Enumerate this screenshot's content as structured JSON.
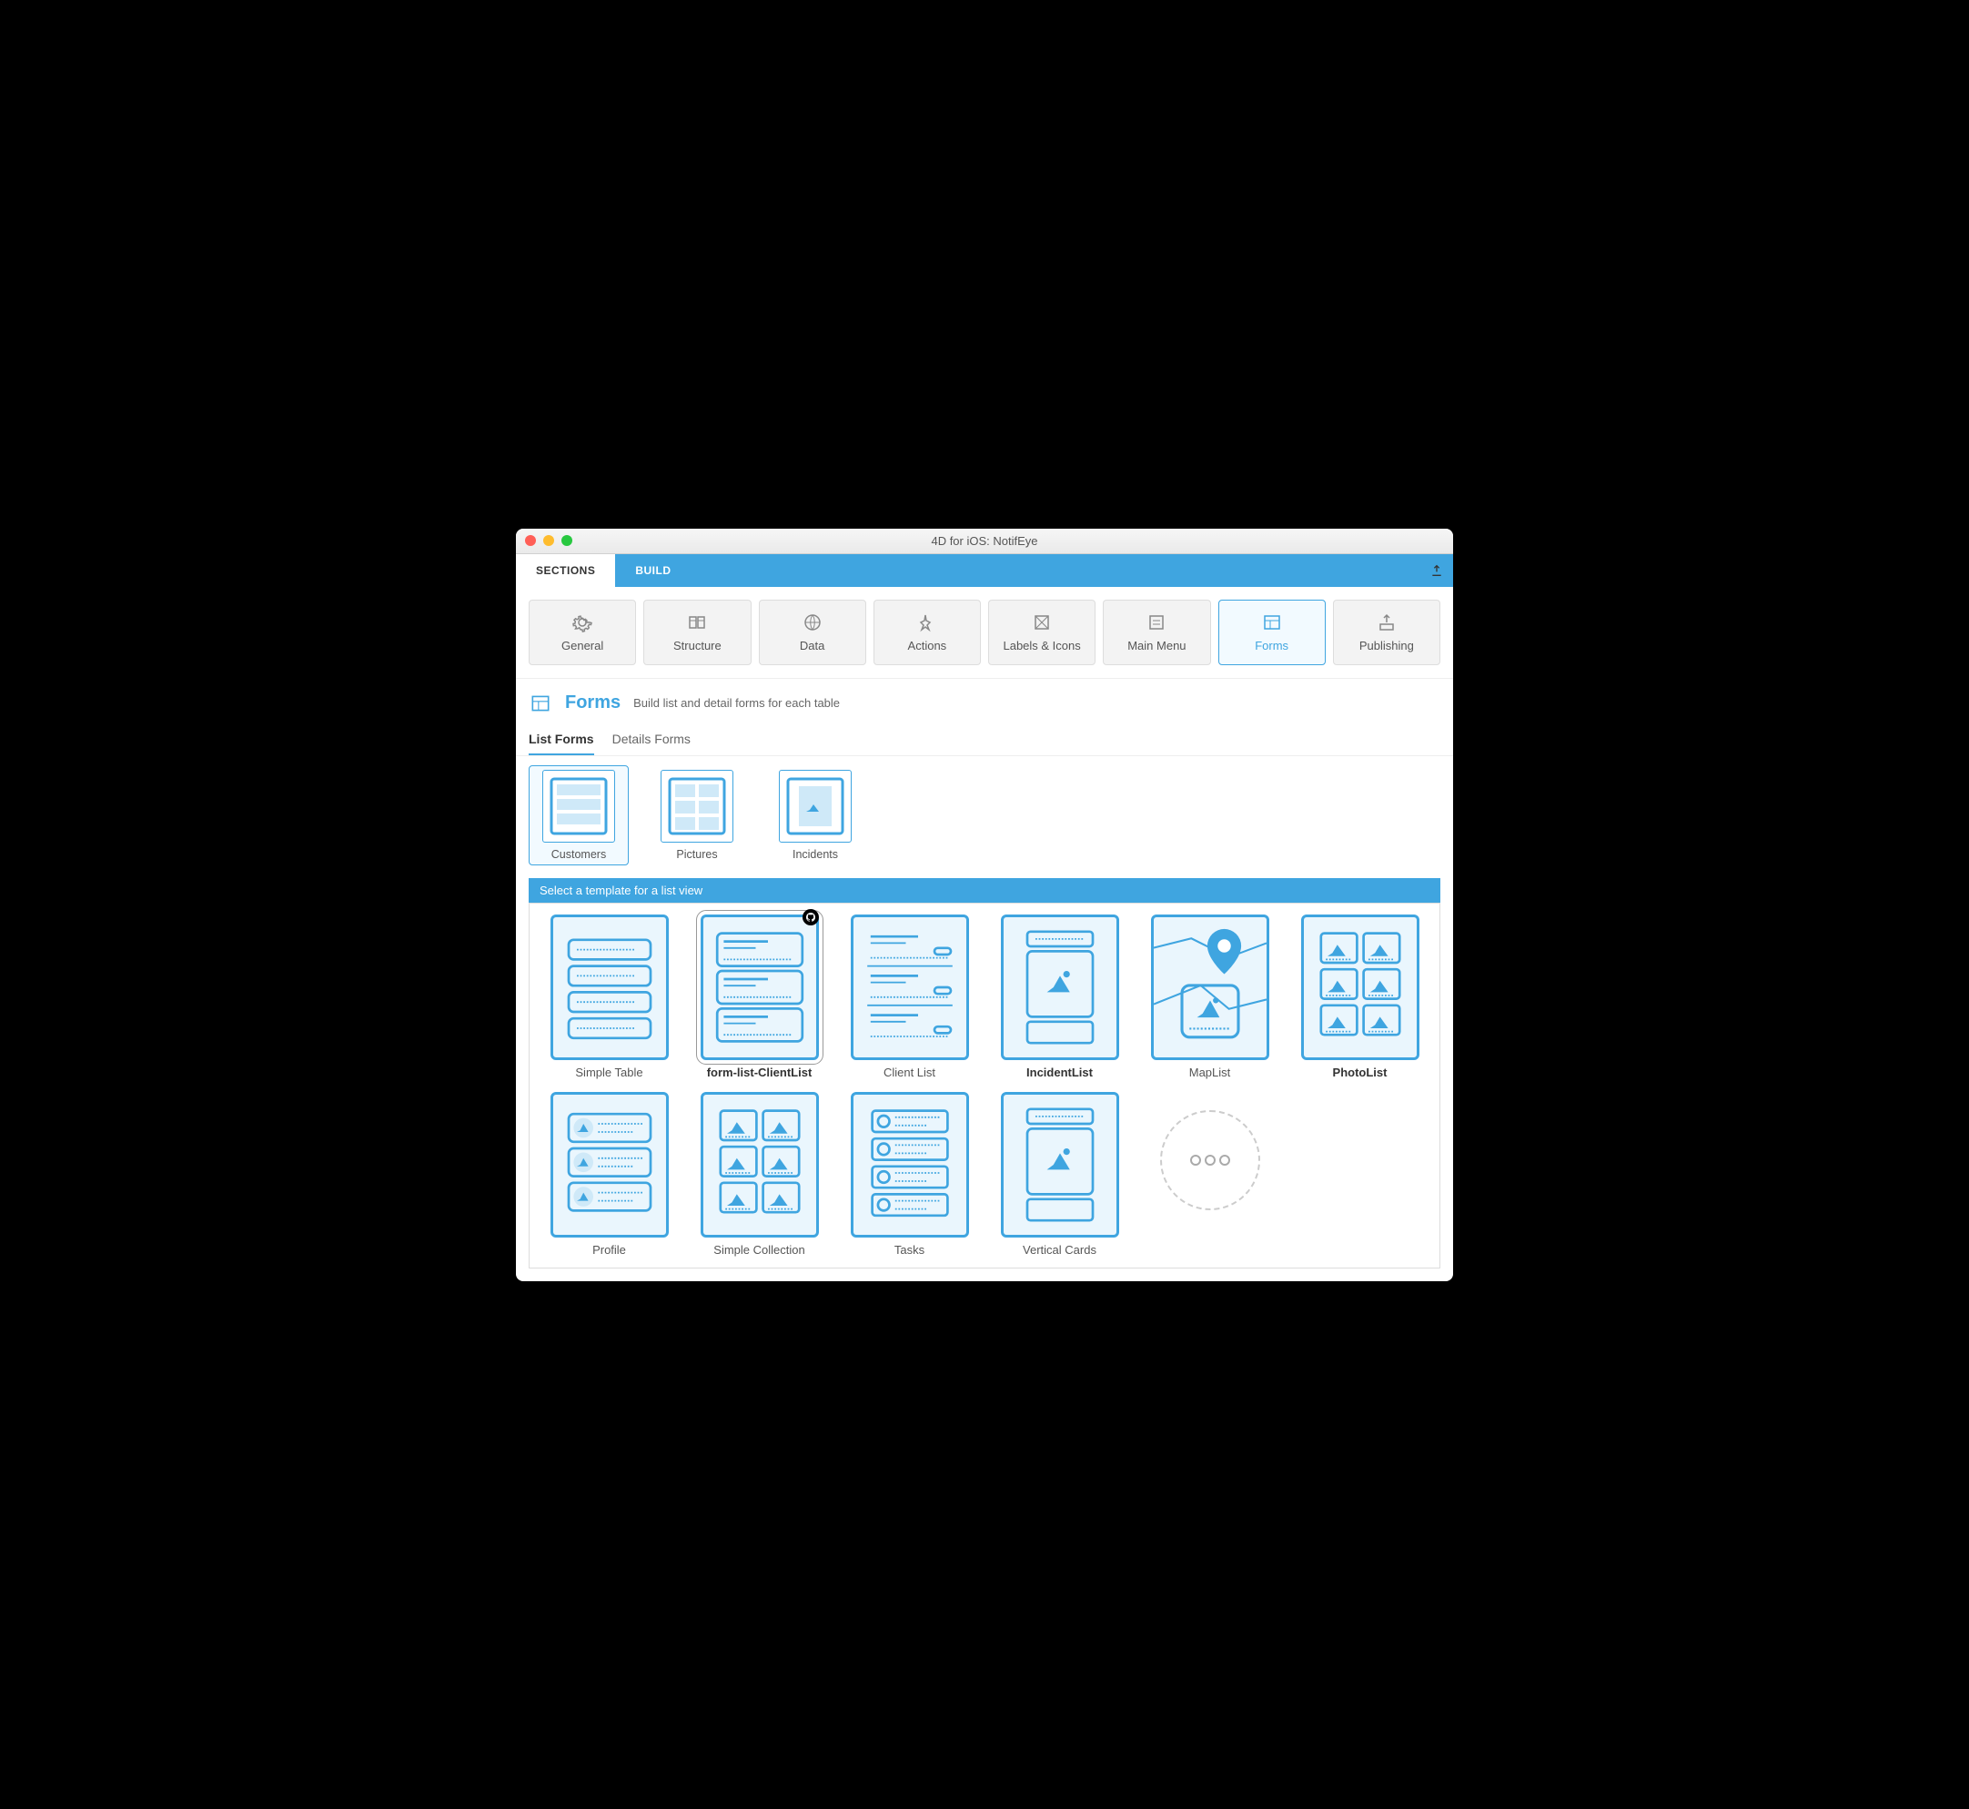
{
  "window": {
    "title": "4D for iOS: NotifEye"
  },
  "topbar": {
    "sections": "SECTIONS",
    "build": "BUILD"
  },
  "sections": [
    {
      "id": "general",
      "label": "General"
    },
    {
      "id": "structure",
      "label": "Structure"
    },
    {
      "id": "data",
      "label": "Data"
    },
    {
      "id": "actions",
      "label": "Actions"
    },
    {
      "id": "labels",
      "label": "Labels & Icons"
    },
    {
      "id": "mainmenu",
      "label": "Main Menu"
    },
    {
      "id": "forms",
      "label": "Forms",
      "active": true
    },
    {
      "id": "publishing",
      "label": "Publishing"
    }
  ],
  "page": {
    "title": "Forms",
    "subtitle": "Build list and detail forms for each table"
  },
  "subtabs": {
    "list": "List Forms",
    "detail": "Details Forms"
  },
  "tables": [
    {
      "id": "customers",
      "label": "Customers",
      "selected": true
    },
    {
      "id": "pictures",
      "label": "Pictures"
    },
    {
      "id": "incidents",
      "label": "Incidents"
    }
  ],
  "templates": {
    "header": "Select a template for a list view",
    "items": [
      {
        "id": "simpletable",
        "label": "Simple Table"
      },
      {
        "id": "clientlist2",
        "label": "form-list-ClientList",
        "selected": true,
        "github": true
      },
      {
        "id": "clientlist",
        "label": "Client List"
      },
      {
        "id": "incidentlist",
        "label": "IncidentList",
        "bold": true
      },
      {
        "id": "maplist",
        "label": "MapList"
      },
      {
        "id": "photolist",
        "label": "PhotoList",
        "bold": true
      },
      {
        "id": "profile",
        "label": "Profile"
      },
      {
        "id": "simplecoll",
        "label": "Simple Collection"
      },
      {
        "id": "tasks",
        "label": "Tasks"
      },
      {
        "id": "vertcards",
        "label": "Vertical Cards"
      }
    ]
  }
}
